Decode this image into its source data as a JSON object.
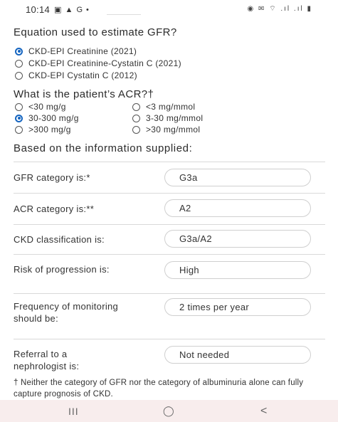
{
  "status": {
    "time": "10:14",
    "left_icons": "▣ ▲ G •",
    "right_icons": "◉ ✉ ⌔ .ıl .ıl ▮"
  },
  "q1": {
    "title": "Equation used to estimate GFR?",
    "options": [
      "CKD-EPI Creatinine (2021)",
      "CKD-EPI Creatinine-Cystatin C (2021)",
      "CKD-EPI Cystatin C (2012)"
    ],
    "selected": 0
  },
  "q2": {
    "title": "What is the patient’s ACR?†",
    "options_left": [
      "<30 mg/g",
      "30-300 mg/g",
      ">300 mg/g"
    ],
    "options_right": [
      "<3 mg/mmol",
      "3-30 mg/mmol",
      ">30 mg/mmol"
    ],
    "selected": "30-300 mg/g"
  },
  "results_title": "Based on the information supplied:",
  "results": [
    {
      "label": "GFR category is:*",
      "value": "G3a"
    },
    {
      "label": "ACR category is:**",
      "value": "A2"
    },
    {
      "label": "CKD classification is:",
      "value": "G3a/A2"
    },
    {
      "label": "Risk of progression is:",
      "value": "High"
    },
    {
      "label": "Frequency of monitoring should be:",
      "value": "2 times per year"
    },
    {
      "label": "Referral to a nephrologist is:",
      "value": "Not needed"
    }
  ],
  "footnote": "† Neither the category of GFR nor the category of albuminuria alone can fully capture prognosis of CKD.",
  "nav": {
    "recents": "III",
    "home": "◯",
    "back": "<"
  }
}
